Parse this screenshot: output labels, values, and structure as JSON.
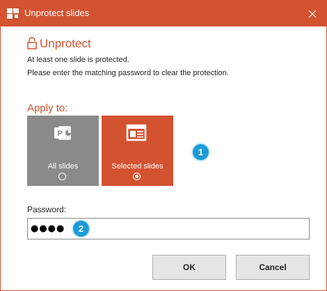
{
  "window": {
    "title": "Unprotect slides",
    "close_icon": "close-icon",
    "app_icon": "powerpoint-addin-icon"
  },
  "header": {
    "heading": "Unprotect",
    "heading_icon": "padlock-open-icon",
    "line1": "At least one slide is protected.",
    "line2": "Please enter the matching password to clear the protection."
  },
  "apply": {
    "label": "Apply to:",
    "options": [
      {
        "label": "All slides",
        "icon": "powerpoint-icon",
        "selected": false,
        "color": "#8a8a8a"
      },
      {
        "label": "Selected slides",
        "icon": "slide-layout-icon",
        "selected": true,
        "color": "#d35230"
      }
    ]
  },
  "password": {
    "label": "Password:",
    "value": "●●●●"
  },
  "callouts": {
    "one": "1",
    "two": "2"
  },
  "buttons": {
    "ok": "OK",
    "cancel": "Cancel"
  },
  "colors": {
    "accent": "#d35230",
    "callout": "#1e9bd7",
    "unselected": "#8a8a8a"
  }
}
